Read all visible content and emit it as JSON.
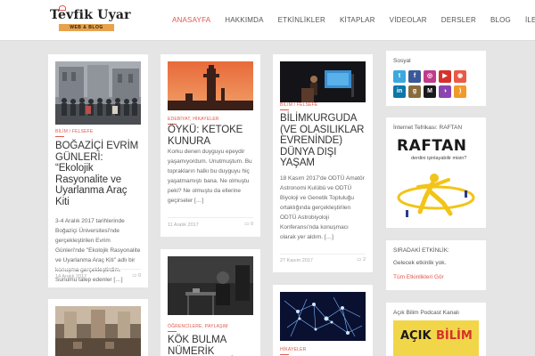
{
  "header": {
    "logo_title": "Tevfik Uyar",
    "logo_subtitle": "WEB & BLOG",
    "nav": [
      "ANASAYFA",
      "HAKKIMDA",
      "ETKİNLİKLER",
      "KİTAPLAR",
      "VİDEOLAR",
      "DERSLER",
      "BLOG",
      "İLETİŞİM"
    ]
  },
  "posts": [
    {
      "category": "BİLİM / FELSEFE",
      "title": "BOĞAZİÇİ EVRİM GÜNLERİ: “Ekolojik Rasyonalite ve Uyarlanma Araç Kiti",
      "excerpt": "3-4 Aralık 2017 tarihlerinde Boğaziçi Üniversitesi'nde gerçekleştirilen Evrim Günleri'nde \"Ekolojik Rasyonalite ve Uyarlanma Araç Kiti\" adlı bir konuşma gerçekleştirdim. Sunumu talep edenler […]",
      "date": "14 Aralık 2017",
      "comments": "0"
    },
    {
      "category": "BİLİM / FELSEFE",
      "title": "",
      "excerpt": "",
      "date": "",
      "comments": ""
    },
    {
      "category": "EDEBİYAT, HİKAYELER",
      "title": "ÖYKÜ: KETOKE KUNURA",
      "excerpt": "Korku denen duyguyu epeydir yaşamıyordum. Unutmuştum. Bu toprakların halkı bu duyguyu hiç yaşatmamıştı bana. Ne olmuştu peki? Ne olmuştu da ellerine geçirseler […]",
      "date": "11 Aralık 2017",
      "comments": "0"
    },
    {
      "category": "ÖĞRENCİLERE, PAYLAŞIM",
      "title": "KÖK BULMA NÜMERİK YÖNTEMLERİ",
      "excerpt": "",
      "date": "",
      "comments": ""
    },
    {
      "category": "BİLİM / FELSEFE",
      "title": "BİLİMKURGUDA (VE OLASILIKLAR EVRENİNDE) DÜNYA DIŞI YAŞAM",
      "excerpt": "18 Kasım 2017'de ODTÜ Amatör Astronomi Kulübü ve ODTÜ Biyoloji ve Genetik Topluluğu ortaklığında gerçekleştirilen ODTÜ Astrobiyoloji Konferansı'nda konuşmacı olarak yer aldım. […]",
      "date": "27 Kasım 2017",
      "comments": "2"
    },
    {
      "category": "HİKAYELER",
      "title": "",
      "excerpt": "",
      "date": "",
      "comments": ""
    }
  ],
  "sidebar": {
    "social_title": "Sosyal",
    "social_icons": [
      "twitter-icon",
      "facebook-icon",
      "instagram-icon",
      "youtube-icon",
      "patreon-icon",
      "linkedin-icon",
      "goodreads-icon",
      "medium-icon",
      "spotify-icon",
      "rss-icon"
    ],
    "raftan_title": "İnternet Tefrikası: RAFTAN",
    "raftan_logo": "RAFTAN",
    "raftan_tagline": "derdini işinlayabilir misin?",
    "events_title": "SIRADAKİ ETKİNLİK:",
    "events_text": "Gelecek etkinlik yok.",
    "events_link": "Tüm Etkinlikleri Gör",
    "podcast_title": "Açık Bilim Podcast Kanalı",
    "podcast_logo_a": "AÇIK",
    "podcast_logo_b": "BİLİM"
  },
  "colors": {
    "accent": "#e0574b",
    "background": "#e5e5e5",
    "band": "#e8a24a"
  }
}
